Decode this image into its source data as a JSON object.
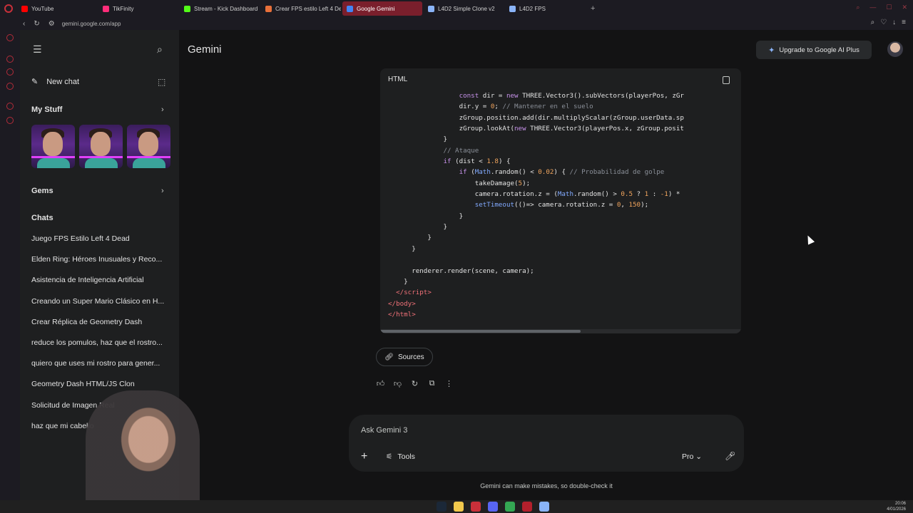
{
  "browser": {
    "tabs": [
      {
        "label": "YouTube",
        "color": "#ff0000",
        "active": false
      },
      {
        "label": "TikFinity",
        "color": "#ff2d7a",
        "active": false
      },
      {
        "label": "Stream - Kick Dashboard",
        "color": "#53fc18",
        "active": false
      },
      {
        "label": "Crear FPS estilo Left 4 De",
        "color": "#e8703a",
        "active": false
      },
      {
        "label": "Google Gemini",
        "color": "#4285f4",
        "active": true
      },
      {
        "label": "L4D2 Simple Clone v2",
        "color": "#8ab4f8",
        "active": false
      },
      {
        "label": "L4D2 FPS",
        "color": "#8ab4f8",
        "active": false
      }
    ],
    "url": "gemini.google.com/app"
  },
  "sidebar": {
    "new_chat": "New chat",
    "my_stuff": "My Stuff",
    "gems": "Gems",
    "chats_heading": "Chats",
    "chats": [
      "Juego FPS Estilo Left 4 Dead",
      "Elden Ring: Héroes Inusuales y Reco...",
      "Asistencia de Inteligencia Artificial",
      "Creando un Super Mario Clásico en H...",
      "Crear Réplica de Geometry Dash",
      "reduce los pomulos, haz que el rostro...",
      "quiero que uses mi rostro para gener...",
      "Geometry Dash HTML/JS Clon",
      "Solicitud de Imagen Real",
      "haz que mi cabello"
    ]
  },
  "header": {
    "title": "Gemini",
    "upgrade": "Upgrade to Google AI Plus"
  },
  "code_block": {
    "language": "HTML"
  },
  "response": {
    "sources": "Sources"
  },
  "prompt": {
    "placeholder": "Ask Gemini 3",
    "tools": "Tools",
    "model": "Pro"
  },
  "footer": {
    "disclaimer": "Gemini can make mistakes, so double-check it"
  },
  "taskbar": {
    "time": "20:06",
    "date": "4/01/2026"
  }
}
